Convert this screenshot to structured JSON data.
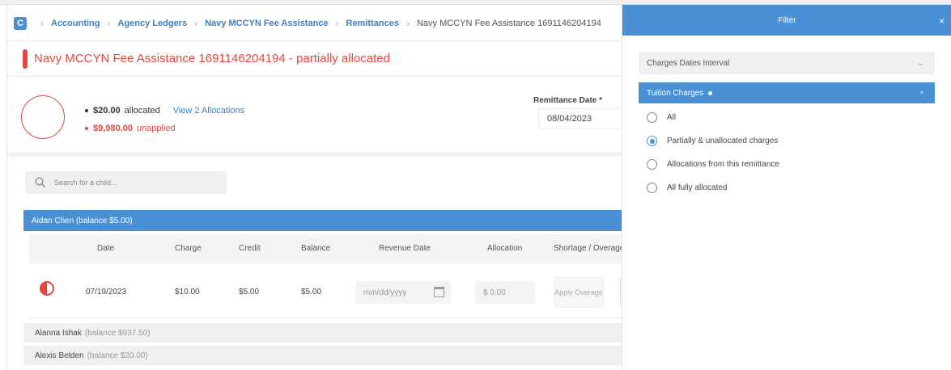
{
  "breadcrumb": {
    "logo": "C",
    "items": [
      {
        "label": "Accounting"
      },
      {
        "label": "Agency Ledgers"
      },
      {
        "label": "Navy MCCYN Fee Assistance"
      },
      {
        "label": "Remittances"
      },
      {
        "label": "Navy MCCYN Fee Assistance 1691146204194"
      }
    ]
  },
  "header": {
    "title": "Navy MCCYN Fee Assistance 1691146204194 - partially allocated",
    "status_color": "#e8453c"
  },
  "summary": {
    "allocated_amount": "$20.00",
    "allocated_label": "allocated",
    "view_link": "View 2 Allocations",
    "unapplied_amount": "$9,980.00",
    "unapplied_label": "unapplied",
    "remittance_date_label": "Remittance Date *",
    "remittance_date": "08/04/2023"
  },
  "search": {
    "placeholder": "Search for a child...",
    "icon": "search-icon"
  },
  "children": [
    {
      "name": "Aidan Chen",
      "balance_text": "(balance $5.00)"
    },
    {
      "name": "Alanna Ishak",
      "balance_text": "(balance $937.50)"
    },
    {
      "name": "Alexis Belden",
      "balance_text": "(balance $20.00)"
    }
  ],
  "table": {
    "columns": [
      "Date",
      "Charge",
      "Credit",
      "Balance",
      "Revenue Date",
      "Allocation",
      "Shortage / Overage"
    ],
    "row": {
      "date": "07/19/2023",
      "charge": "$10.00",
      "credit": "$5.00",
      "balance": "$5.00",
      "revenue_date_placeholder": "mm/dd/yyyy",
      "allocation_value": "$  0.00",
      "apply_button": "Apply Overage"
    }
  },
  "filter": {
    "title": "Filter",
    "close": "×",
    "sections": [
      {
        "label": "Charges Dates Interval",
        "expanded": false
      },
      {
        "label": "Tuition Charges",
        "expanded": true
      }
    ],
    "options": [
      {
        "label": "All",
        "selected": false
      },
      {
        "label": "Partially & unallocated charges",
        "selected": true
      },
      {
        "label": "Allocations from this remittance",
        "selected": false
      },
      {
        "label": "All fully allocated",
        "selected": false
      }
    ]
  },
  "colors": {
    "accent": "#4a90d4",
    "danger": "#e8453c",
    "link": "#3d7fc4"
  }
}
